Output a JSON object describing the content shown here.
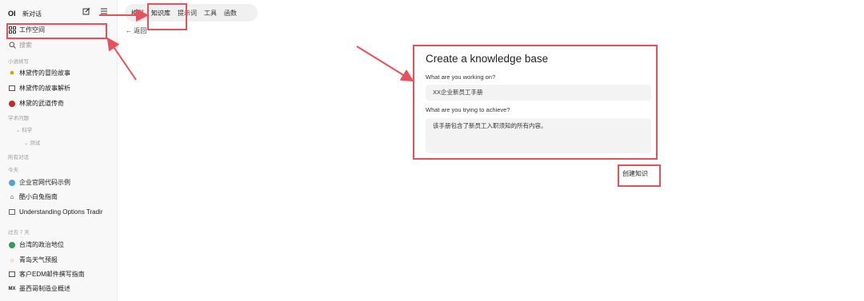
{
  "sidebar": {
    "logo": "OI",
    "new_chat": "新对话",
    "workspace": "工作空间",
    "search": "搜索",
    "sections": {
      "novel": "小说续写",
      "study": "学术问题",
      "all": "所有对话",
      "today": "今天",
      "past7": "过去 7 天"
    },
    "novel_items": [
      "林黛传的冒险故事",
      "林黛传的故事解析",
      "林黛的武道传奇"
    ],
    "study_sub": "科学",
    "study_sub2": "测试",
    "today_items": [
      "企业官网代码示例",
      "酷小白兔指南",
      "Understanding Options Tradir"
    ],
    "past7_items": [
      "台湾的政治地位",
      "青岛天气预报",
      "客户EDM邮件撰写指南",
      "墨西哥制造业概述"
    ],
    "past7_icon_mx": "MX"
  },
  "tabs": [
    "模型",
    "知识库",
    "提示词",
    "工具",
    "函数"
  ],
  "back_label": "返回",
  "form": {
    "title": "Create a knowledge base",
    "q1_label": "What are you working on?",
    "q1_value": "XX企业新员工手册",
    "q2_label": "What are you trying to achieve?",
    "q2_value": "该手册包含了新员工入职须知的所有内容。",
    "create_button": "创建知识"
  },
  "colors": {
    "annotation": "#e8505b",
    "sidebar_bg": "#f8f8f8",
    "field_bg": "#f3f3f3"
  }
}
